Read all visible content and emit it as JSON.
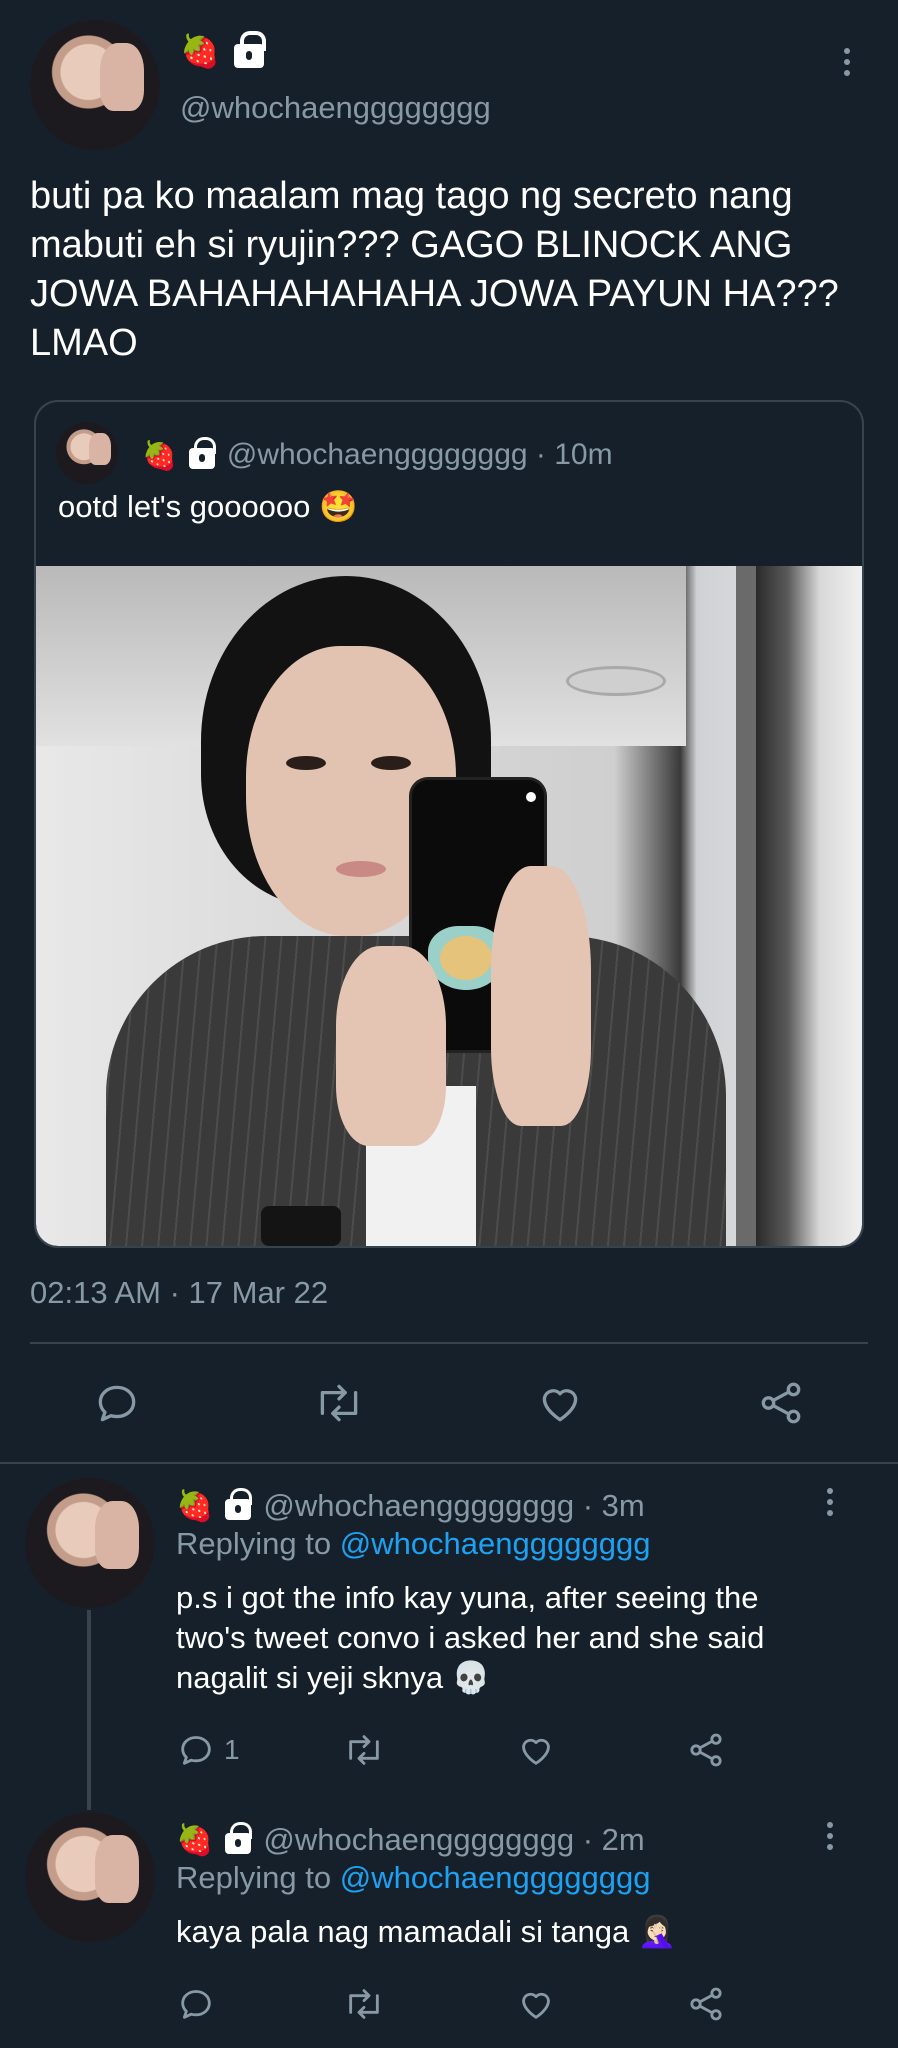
{
  "main_tweet": {
    "handle": "@whochaengggggggg",
    "name_emojis": "🍓",
    "text": "buti pa ko maalam mag tago ng secreto nang mabuti eh si ryujin??? GAGO BLINOCK ANG JOWA BAHAHAHAHAHA JOWA PAYUN HA??? LMAO",
    "timestamp": "02:13 AM · 17 Mar 22"
  },
  "quoted_tweet": {
    "name_emojis": "🍓",
    "handle_time": "@whochaengggggggg · 10m",
    "text": "ootd let's goooooo 🤩"
  },
  "replies": [
    {
      "name_emojis": "🍓",
      "handle_time": "@whochaengggggggg · 3m",
      "replying_label": "Replying to",
      "replying_handle": "@whochaengggggggg",
      "text": "p.s i got the info kay yuna, after seeing the two's tweet convo i asked her and she said nagalit si yeji sknya 💀",
      "reply_count": "1"
    },
    {
      "name_emojis": "🍓",
      "handle_time": "@whochaengggggggg · 2m",
      "replying_label": "Replying to",
      "replying_handle": "@whochaengggggggg",
      "text": "kaya pala nag mamadali si tanga 🤦🏻‍♀️",
      "reply_count": ""
    }
  ],
  "icons": [
    "more-icon",
    "lock-icon",
    "reply-icon",
    "retweet-icon",
    "like-icon",
    "share-icon"
  ],
  "colors": {
    "background": "#15202b",
    "muted": "#8899a6",
    "link": "#1da1f2",
    "divider": "#38444d"
  }
}
